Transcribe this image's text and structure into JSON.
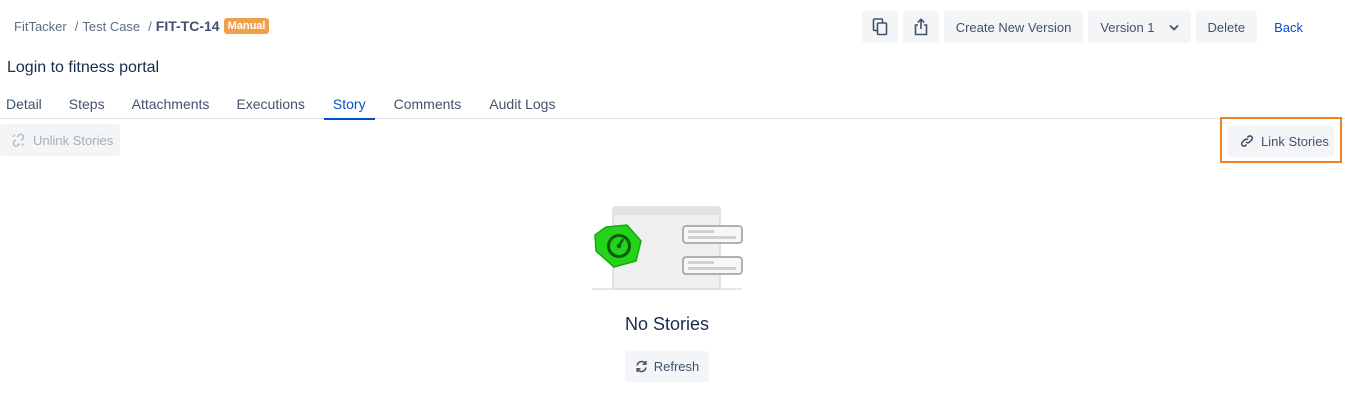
{
  "breadcrumb": {
    "project": "FitTacker",
    "section": "Test Case",
    "key": "FIT-TC-14",
    "type_badge": "Manual",
    "separator": "/"
  },
  "header_actions": {
    "copy_icon": "copy-icon",
    "share_icon": "share-icon",
    "create_version_label": "Create New Version",
    "version_label": "Version 1",
    "delete_label": "Delete",
    "back_label": "Back"
  },
  "title": "Login to fitness portal",
  "tabs": [
    {
      "label": "Detail"
    },
    {
      "label": "Steps"
    },
    {
      "label": "Attachments"
    },
    {
      "label": "Executions"
    },
    {
      "label": "Story",
      "active": true
    },
    {
      "label": "Comments"
    },
    {
      "label": "Audit Logs"
    }
  ],
  "toolbar": {
    "unlink_label": "Unlink Stories",
    "link_label": "Link Stories"
  },
  "empty_state": {
    "title": "No Stories",
    "refresh_label": "Refresh"
  },
  "colors": {
    "accent": "#0052cc",
    "badge": "#f0a04b",
    "highlight": "#f0811f",
    "illustration_green": "#22d319"
  }
}
